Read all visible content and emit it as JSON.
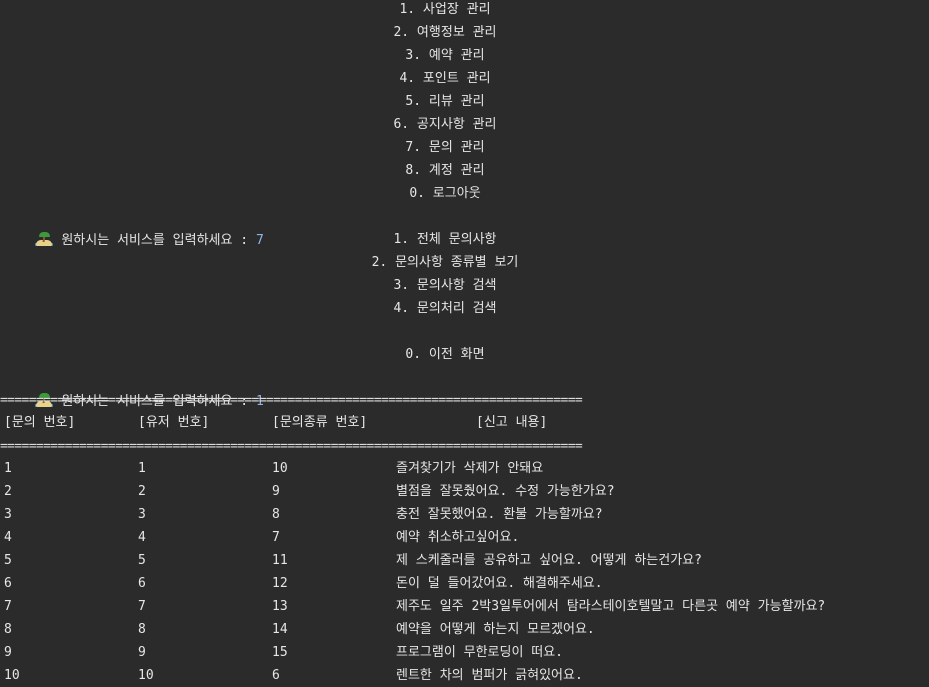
{
  "main_menu": {
    "items": [
      "1. 사업장 관리",
      "2. 여행정보 관리",
      "3. 예약 관리",
      "4. 포인트 관리",
      "5. 리뷰 관리",
      "6. 공지사항 관리",
      "7. 문의 관리",
      "8. 계정 관리",
      "0. 로그아웃"
    ]
  },
  "prompt1": {
    "icon": "desert-island-icon",
    "text": "원하시는 서비스를 입력하세요 : ",
    "value": "7"
  },
  "inquiry_menu": {
    "items": [
      "1. 전체 문의사항",
      "2. 문의사항 종류별 보기",
      "3. 문의사항 검색",
      "4. 문의처리 검색",
      "",
      "0. 이전 화면"
    ]
  },
  "prompt2": {
    "icon": "desert-island-icon",
    "text": "원하시는 서비스를 입력하세요 : ",
    "value": "1"
  },
  "table": {
    "separator": "=================================================================================",
    "headers": [
      "[문의 번호]",
      "[유저 번호]",
      "[문의종류 번호]",
      "[신고 내용]"
    ],
    "rows": [
      [
        "1",
        "1",
        "10",
        "즐겨찾기가 삭제가 안돼요"
      ],
      [
        "2",
        "2",
        "9",
        "별점을 잘못줬어요. 수정 가능한가요?"
      ],
      [
        "3",
        "3",
        "8",
        "충전 잘못했어요. 환불 가능할까요?"
      ],
      [
        "4",
        "4",
        "7",
        "예약 취소하고싶어요."
      ],
      [
        "5",
        "5",
        "11",
        "제 스케줄러를 공유하고 싶어요. 어떻게 하는건가요?"
      ],
      [
        "6",
        "6",
        "12",
        "돈이 덜 들어갔어요. 해결해주세요."
      ],
      [
        "7",
        "7",
        "13",
        "제주도 일주 2박3일투어에서 탐라스테이호텔말고 다른곳 예약 가능할까요?"
      ],
      [
        "8",
        "8",
        "14",
        "예약을 어떻게 하는지 모르겠어요."
      ],
      [
        "9",
        "9",
        "15",
        "프로그램이 무한로딩이 떠요."
      ],
      [
        "10",
        "10",
        "6",
        "렌트한 차의 범퍼가 긁혀있어요."
      ]
    ]
  }
}
